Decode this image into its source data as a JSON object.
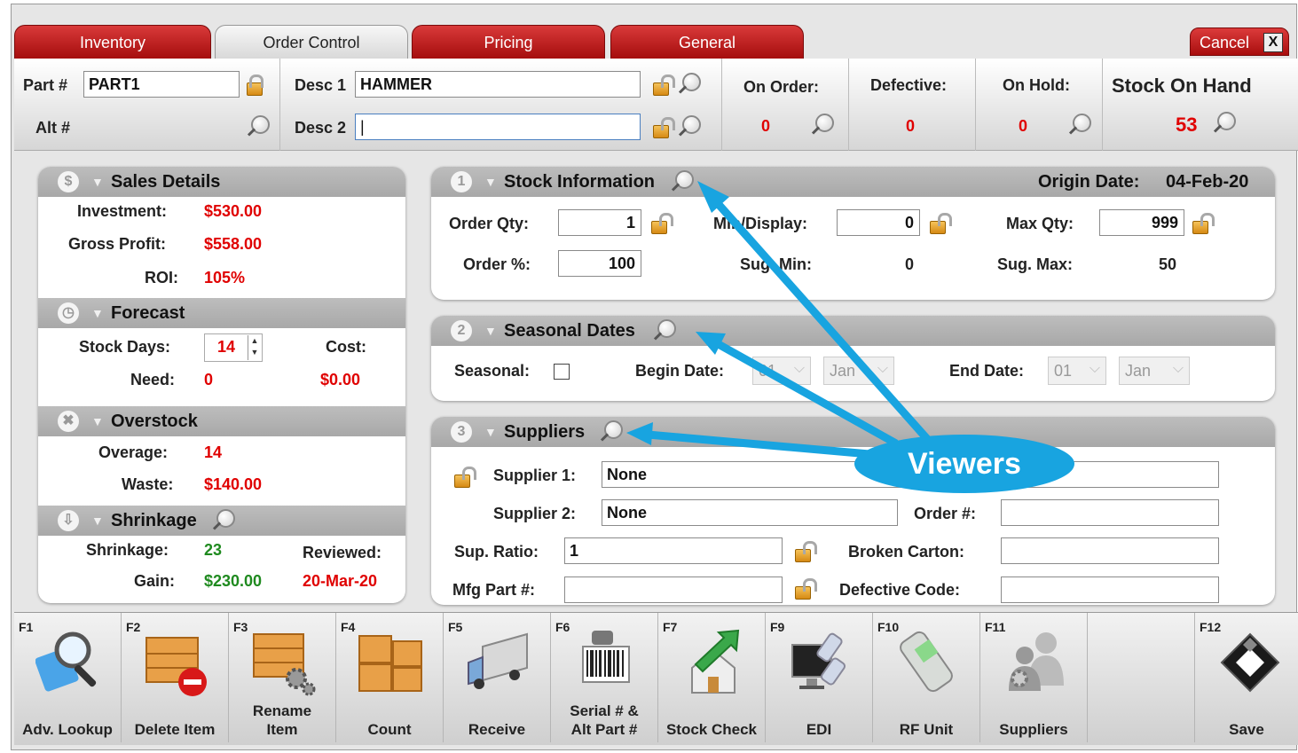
{
  "tabs": [
    {
      "label": "Inventory",
      "active": false
    },
    {
      "label": "Order Control",
      "active": true
    },
    {
      "label": "Pricing",
      "active": false
    },
    {
      "label": "General",
      "active": false
    }
  ],
  "cancel_label": "Cancel",
  "cancel_x": "X",
  "header": {
    "part_label": "Part #",
    "part_value": "PART1",
    "alt_label": "Alt #",
    "alt_value": "",
    "desc1_label": "Desc 1",
    "desc1_value": "HAMMER",
    "desc2_label": "Desc 2",
    "desc2_value": "|",
    "on_order_label": "On Order:",
    "on_order_value": "0",
    "defective_label": "Defective:",
    "defective_value": "0",
    "on_hold_label": "On Hold:",
    "on_hold_value": "0",
    "stock_on_hand_label": "Stock On Hand",
    "stock_on_hand_value": "53"
  },
  "sales": {
    "badge": "$",
    "title": "Sales Details",
    "investment_label": "Investment:",
    "investment_value": "$530.00",
    "gross_profit_label": "Gross Profit:",
    "gross_profit_value": "$558.00",
    "roi_label": "ROI:",
    "roi_value": "105%"
  },
  "forecast": {
    "title": "Forecast",
    "stock_days_label": "Stock Days:",
    "stock_days_value": "14",
    "cost_label": "Cost:",
    "cost_value": "$0.00",
    "need_label": "Need:",
    "need_value": "0"
  },
  "overstock": {
    "title": "Overstock",
    "overage_label": "Overage:",
    "overage_value": "14",
    "waste_label": "Waste:",
    "waste_value": "$140.00"
  },
  "shrinkage": {
    "title": "Shrinkage",
    "shrinkage_label": "Shrinkage:",
    "shrinkage_value": "23",
    "reviewed_label": "Reviewed:",
    "reviewed_value": "20-Mar-20",
    "gain_label": "Gain:",
    "gain_value": "$230.00"
  },
  "stock_info": {
    "badge": "1",
    "title": "Stock Information",
    "origin_label": "Origin Date:",
    "origin_value": "04-Feb-20",
    "order_qty_label": "Order Qty:",
    "order_qty_value": "1",
    "min_display_label": "Min/Display:",
    "min_display_value": "0",
    "max_qty_label": "Max Qty:",
    "max_qty_value": "999",
    "order_pct_label": "Order %:",
    "order_pct_value": "100",
    "sug_min_label": "Sug. Min:",
    "sug_min_value": "0",
    "sug_max_label": "Sug. Max:",
    "sug_max_value": "50"
  },
  "seasonal": {
    "badge": "2",
    "title": "Seasonal Dates",
    "seasonal_label": "Seasonal:",
    "begin_label": "Begin Date:",
    "begin_day": "01",
    "begin_month": "Jan",
    "end_label": "End Date:",
    "end_day": "01",
    "end_month": "Jan"
  },
  "suppliers": {
    "badge": "3",
    "title": "Suppliers",
    "supplier1_label": "Supplier 1:",
    "supplier1_value": "None",
    "supplier2_label": "Supplier 2:",
    "supplier2_value": "None",
    "order_num_label": "Order #:",
    "sup_ratio_label": "Sup. Ratio:",
    "sup_ratio_value": "1",
    "broken_carton_label": "Broken Carton:",
    "mfg_part_label": "Mfg Part #:",
    "defective_code_label": "Defective Code:"
  },
  "toolbar": [
    {
      "key": "F1",
      "label": "Adv. Lookup",
      "icon": "magnifier-icon"
    },
    {
      "key": "F2",
      "label": "Delete Item",
      "icon": "crate-delete-icon"
    },
    {
      "key": "F3",
      "label": "Rename Item",
      "icon": "crate-gears-icon"
    },
    {
      "key": "F4",
      "label": "Count",
      "icon": "stacked-crates-icon"
    },
    {
      "key": "F5",
      "label": "Receive",
      "icon": "truck-icon"
    },
    {
      "key": "F6",
      "label": "Serial # & Alt Part #",
      "icon": "barcode-scanner-icon"
    },
    {
      "key": "F7",
      "label": "Stock Check",
      "icon": "house-arrow-icon"
    },
    {
      "key": "F9",
      "label": "EDI",
      "icon": "computer-plug-icon"
    },
    {
      "key": "F10",
      "label": "RF Unit",
      "icon": "handheld-scanner-icon"
    },
    {
      "key": "F11",
      "label": "Suppliers",
      "icon": "people-gears-icon"
    },
    {
      "key": "",
      "label": "",
      "icon": ""
    },
    {
      "key": "F12",
      "label": "Save",
      "icon": "floppy-disk-icon"
    }
  ],
  "annotation": {
    "label": "Viewers",
    "color": "#18a4e0"
  }
}
